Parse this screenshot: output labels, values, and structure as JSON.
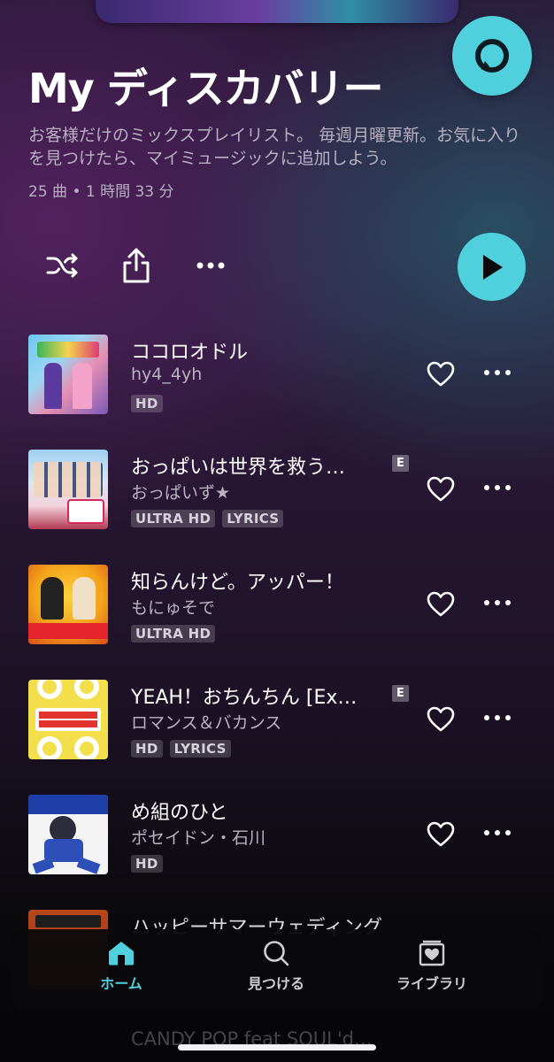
{
  "header": {
    "title": "My ディスカバリー",
    "description": "お客様だけのミックスプレイリスト。 毎週月曜更新。お気に入りを見つけたら、マイミュージックに追加しよう。",
    "meta": "25 曲 • 1 時間 33 分"
  },
  "colors": {
    "accent": "#4fd0dc"
  },
  "tracks": [
    {
      "title": "ココロオドル",
      "artist": "hy4_4yh",
      "badges": [
        "HD"
      ],
      "explicit": false
    },
    {
      "title": "おっぱいは世界を救う…",
      "artist": "おっぱいず★",
      "badges": [
        "ULTRA HD",
        "LYRICS"
      ],
      "explicit": true,
      "explicit_label": "E"
    },
    {
      "title": "知らんけど。アッパー！",
      "artist": "もにゅそで",
      "badges": [
        "ULTRA HD"
      ],
      "explicit": false
    },
    {
      "title": "YEAH！おちんちん [Ex…",
      "artist": "ロマンス＆バカンス",
      "badges": [
        "HD",
        "LYRICS"
      ],
      "explicit": true,
      "explicit_label": "E"
    },
    {
      "title": "め組のひと",
      "artist": "ポセイドン・石川",
      "badges": [
        "HD"
      ],
      "explicit": false
    },
    {
      "title": "ハッピーサマーウェディング",
      "artist": "",
      "badges": [],
      "explicit": false
    }
  ],
  "ghost_track": {
    "title": "CANDY POP feat SOUL'd…"
  },
  "nav": {
    "home": "ホーム",
    "discover": "見つける",
    "library": "ライブラリ"
  },
  "icons": [
    "alexa-icon",
    "shuffle-icon",
    "share-icon",
    "more-icon",
    "play-icon",
    "heart-icon",
    "home-icon",
    "search-icon",
    "library-icon"
  ]
}
